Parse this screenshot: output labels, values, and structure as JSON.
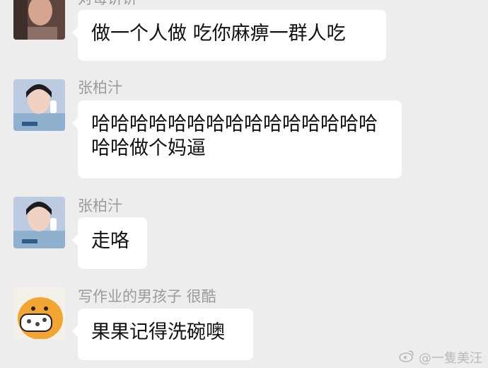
{
  "messages": [
    {
      "sender": "对每讲讲",
      "text": "做一个人做 吃你麻痹一群人吃",
      "avatar": "photo-avatar"
    },
    {
      "sender": "张柏汁",
      "text": "哈哈哈哈哈哈哈哈哈哈哈哈哈哈哈哈哈做个妈逼",
      "avatar": "woman-phone-avatar"
    },
    {
      "sender": "张柏汁",
      "text": "走咯",
      "avatar": "woman-phone-avatar"
    },
    {
      "sender": "写作业的男孩子 很酷",
      "text": "果果记得洗碗噢",
      "avatar": "duck-cartoon-avatar"
    }
  ],
  "watermark": {
    "text": "@一隻美汪",
    "icon": "weibo-icon"
  },
  "colors": {
    "background": "#ededed",
    "bubble": "#ffffff",
    "sender_text": "#9b9b9b",
    "message_text": "#111111"
  }
}
